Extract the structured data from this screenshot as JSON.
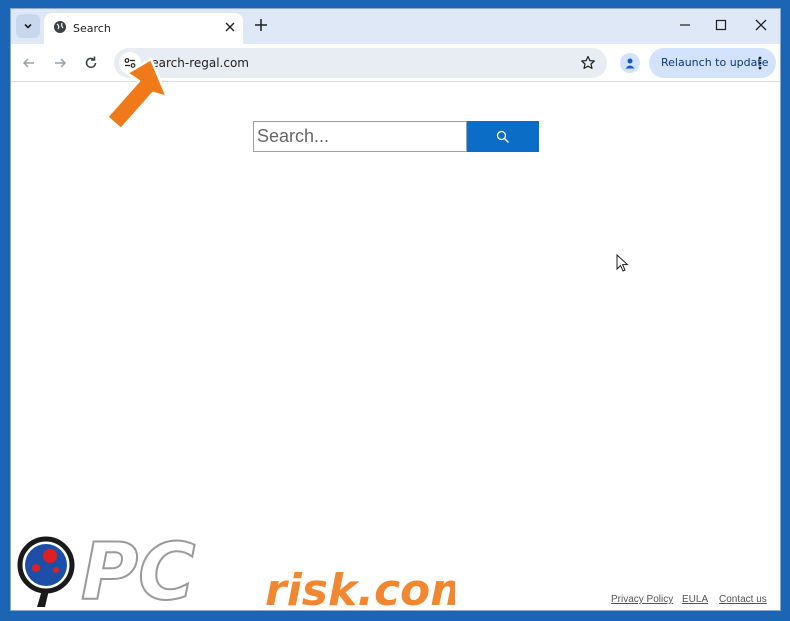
{
  "tab": {
    "title": "Search",
    "favicon": "globe-icon"
  },
  "omnibox": {
    "url": "search-regal.com"
  },
  "toolbar": {
    "relaunch_label": "Relaunch to update"
  },
  "search": {
    "placeholder": "Search...",
    "button_icon": "search-icon"
  },
  "footer": {
    "privacy": "Privacy Policy",
    "eula": "EULA",
    "contact": "Contact us"
  },
  "watermark": {
    "text_pc": "PC",
    "text_risk": "risk.com"
  },
  "colors": {
    "desktop": "#1c64b4",
    "search_button": "#0b6dc6",
    "arrow": "#f07a1a",
    "relaunch_bg": "#d3e3fd"
  }
}
